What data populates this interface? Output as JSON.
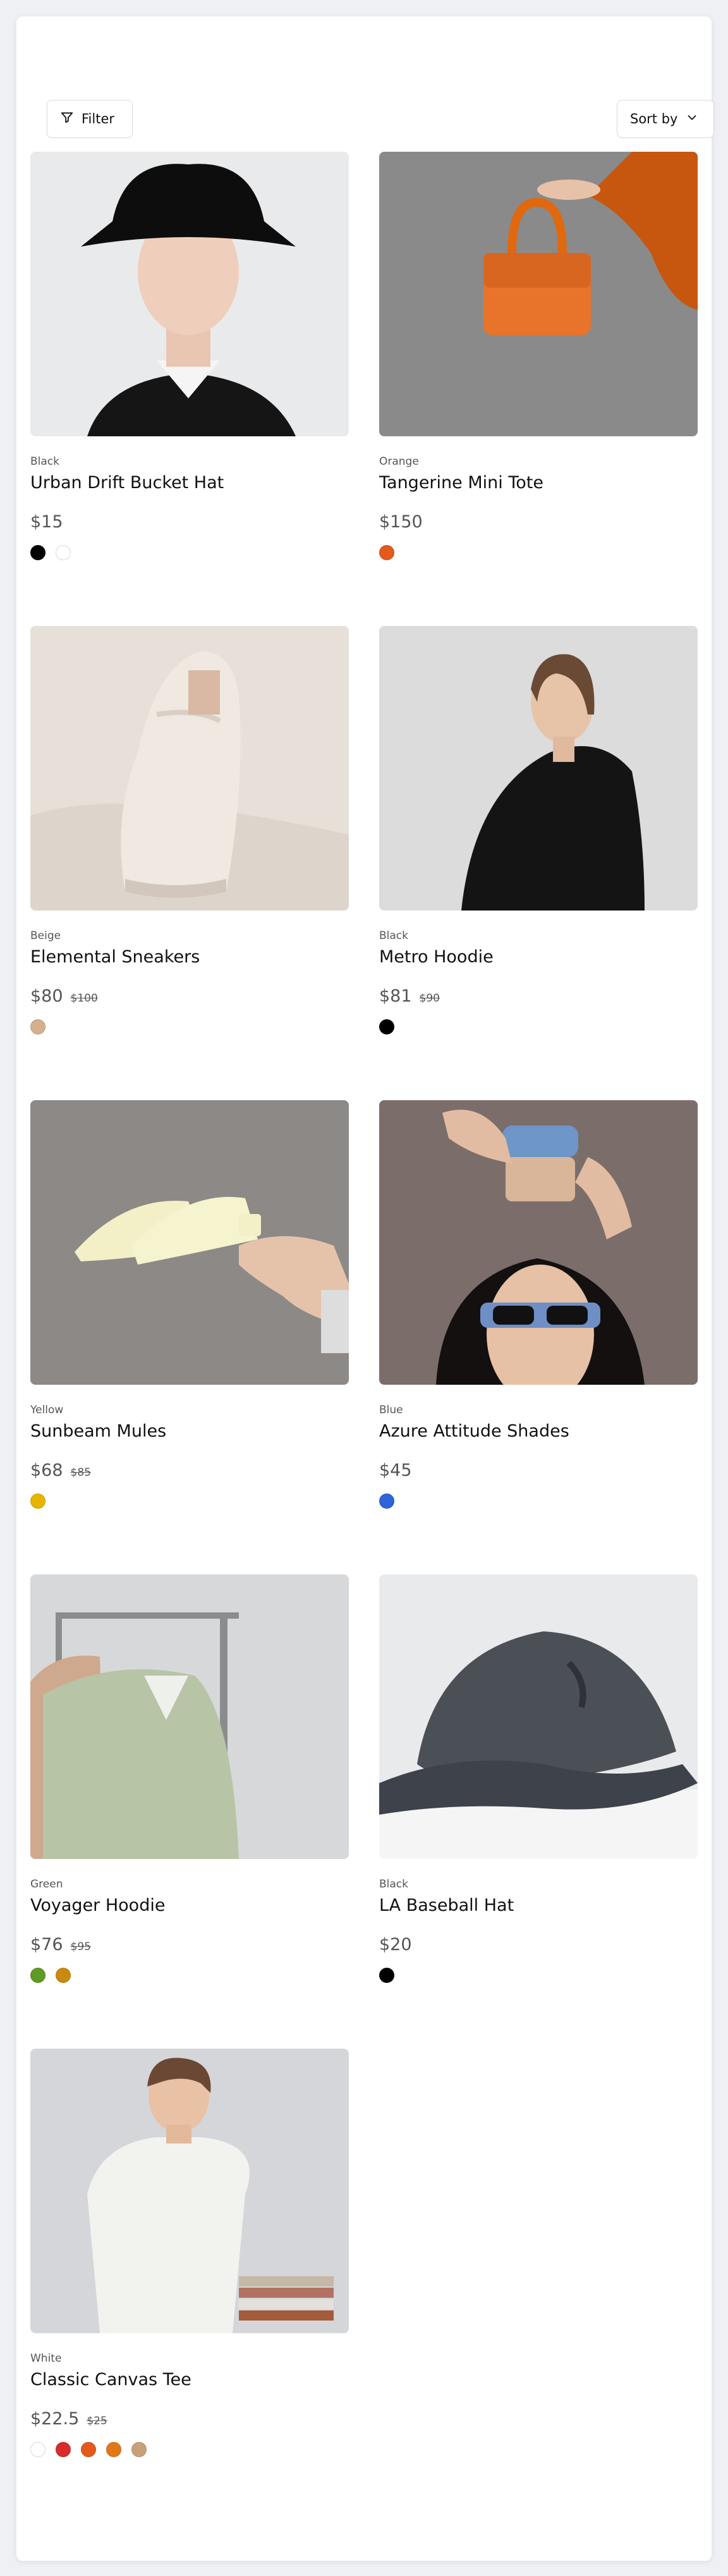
{
  "toolbar": {
    "filter_label": "Filter",
    "sort_label": "Sort by"
  },
  "products": [
    {
      "color_name": "Black",
      "title": "Urban Drift Bucket Hat",
      "price": "$15",
      "compare_price": "",
      "swatches": [
        "#000000",
        "#ffffff"
      ]
    },
    {
      "color_name": "Orange",
      "title": "Tangerine Mini Tote",
      "price": "$150",
      "compare_price": "",
      "swatches": [
        "#e35a1c"
      ]
    },
    {
      "color_name": "Beige",
      "title": "Elemental Sneakers",
      "price": "$80",
      "compare_price": "$100",
      "swatches": [
        "#d4b08e"
      ]
    },
    {
      "color_name": "Black",
      "title": "Metro Hoodie",
      "price": "$81",
      "compare_price": "$90",
      "swatches": [
        "#000000"
      ]
    },
    {
      "color_name": "Yellow",
      "title": "Sunbeam Mules",
      "price": "$68",
      "compare_price": "$85",
      "swatches": [
        "#e8b400"
      ]
    },
    {
      "color_name": "Blue",
      "title": "Azure Attitude Shades",
      "price": "$45",
      "compare_price": "",
      "swatches": [
        "#2e63d9"
      ]
    },
    {
      "color_name": "Green",
      "title": "Voyager Hoodie",
      "price": "$76",
      "compare_price": "$95",
      "swatches": [
        "#5f9a22",
        "#c98a10"
      ]
    },
    {
      "color_name": "Black",
      "title": "LA Baseball Hat",
      "price": "$20",
      "compare_price": "",
      "swatches": [
        "#000000"
      ]
    },
    {
      "color_name": "White",
      "title": "Classic Canvas Tee",
      "price": "$22.5",
      "compare_price": "$25",
      "swatches": [
        "#ffffff",
        "#d92b2b",
        "#e35a1c",
        "#e0781a",
        "#c8a07a"
      ]
    }
  ]
}
